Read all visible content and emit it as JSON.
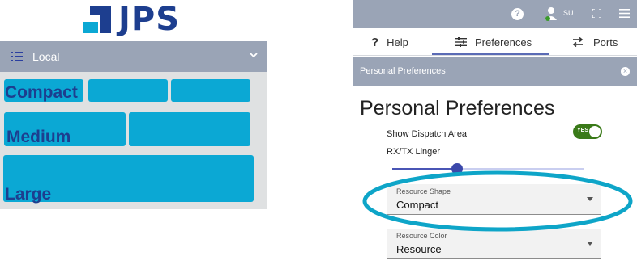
{
  "logo": {
    "text": "JPS"
  },
  "left_panel": {
    "header_label": "Local",
    "tiles": [
      {
        "label": "Compact"
      },
      {
        "label": "Medium"
      },
      {
        "label": "Large"
      }
    ]
  },
  "topbar": {
    "user": "SU"
  },
  "tabs": [
    {
      "label": "Help",
      "icon": "question-mark-icon"
    },
    {
      "label": "Preferences",
      "icon": "sliders-icon"
    },
    {
      "label": "Ports",
      "icon": "swap-arrows-icon"
    }
  ],
  "active_tab": "Preferences",
  "section_bar": {
    "title": "Personal Preferences"
  },
  "page_title": "Personal Preferences",
  "dispatch_area": {
    "label": "Show Dispatch Area",
    "toggle_text": "YES",
    "enabled": true
  },
  "linger": {
    "label": "RX/TX Linger",
    "slider_fraction": 0.34
  },
  "resource_shape": {
    "label": "Resource Shape",
    "value": "Compact"
  },
  "resource_color": {
    "label": "Resource Color",
    "value": "Resource"
  },
  "colors": {
    "tile": "#0ba8d4",
    "brand_navy": "#1d3e8f",
    "toggle_on": "#3a7a19",
    "highlight_ring": "#0ea5c8",
    "header_gray": "#9aa4b6"
  }
}
